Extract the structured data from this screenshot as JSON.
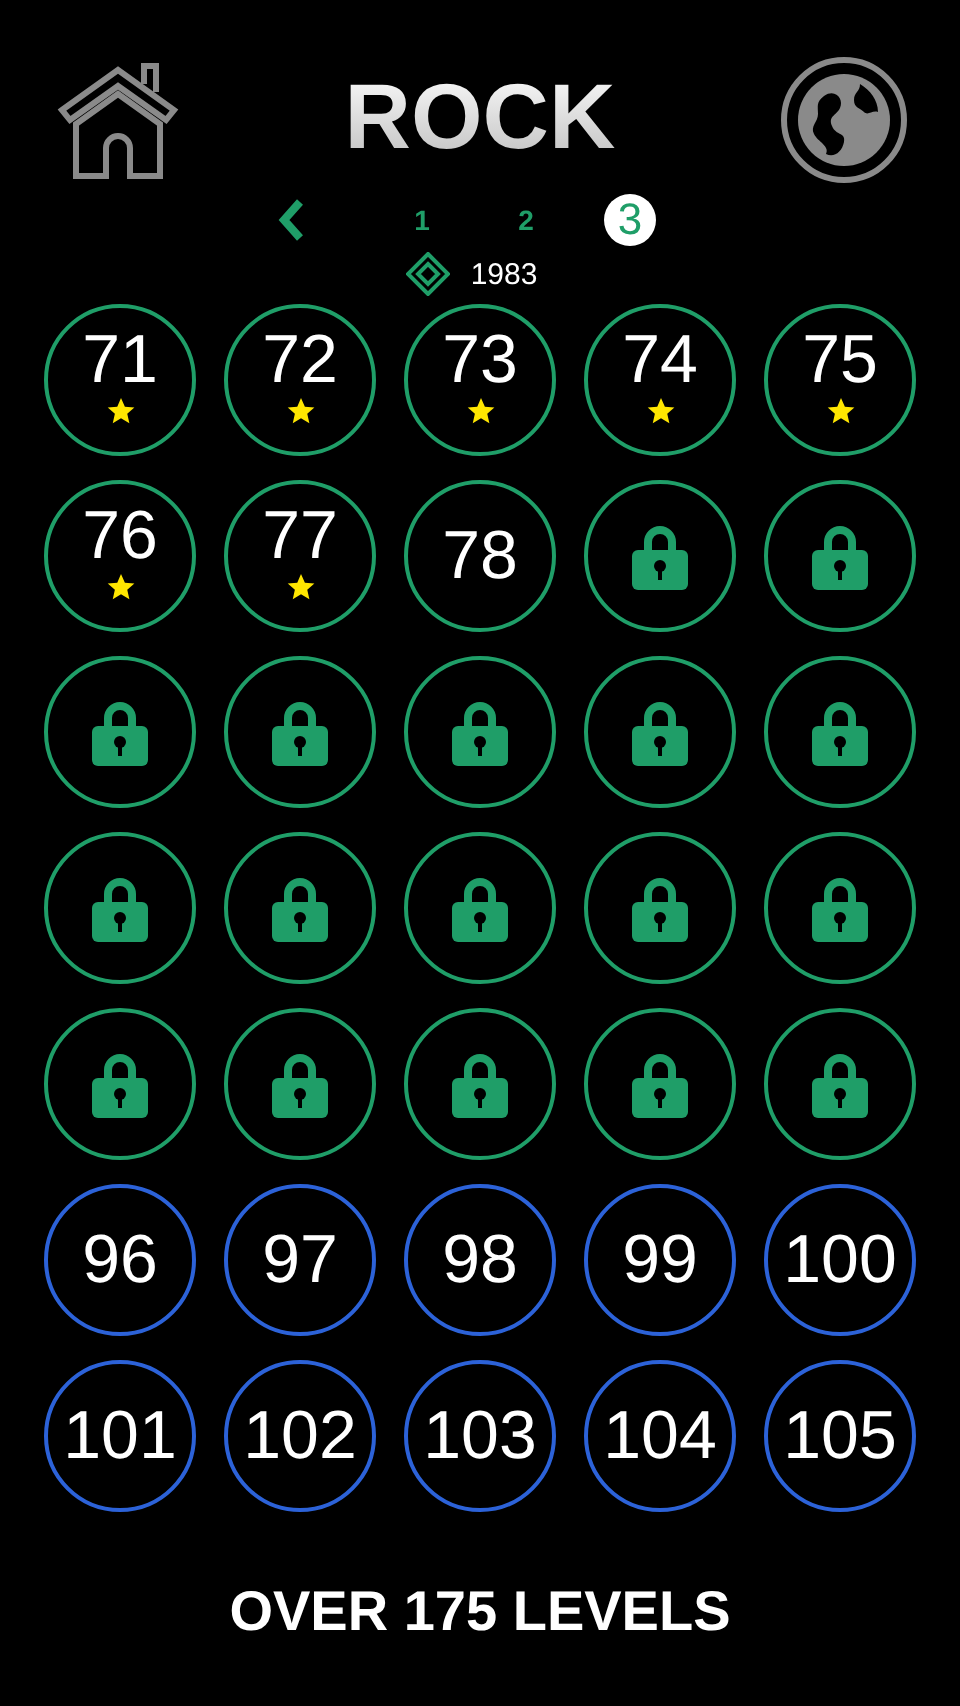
{
  "title": "ROCK",
  "pages": [
    {
      "label": "1",
      "selected": false
    },
    {
      "label": "2",
      "selected": false
    },
    {
      "label": "3",
      "selected": true
    }
  ],
  "score": "1983",
  "levels": [
    {
      "kind": "open",
      "label": "71",
      "starred": true,
      "color": "#1f9e68"
    },
    {
      "kind": "open",
      "label": "72",
      "starred": true,
      "color": "#1f9e68"
    },
    {
      "kind": "open",
      "label": "73",
      "starred": true,
      "color": "#1f9e68"
    },
    {
      "kind": "open",
      "label": "74",
      "starred": true,
      "color": "#1f9e68"
    },
    {
      "kind": "open",
      "label": "75",
      "starred": true,
      "color": "#1f9e68"
    },
    {
      "kind": "open",
      "label": "76",
      "starred": true,
      "color": "#1f9e68"
    },
    {
      "kind": "open",
      "label": "77",
      "starred": true,
      "color": "#1f9e68"
    },
    {
      "kind": "open",
      "label": "78",
      "starred": false,
      "color": "#1f9e68"
    },
    {
      "kind": "locked",
      "color": "#1f9e68"
    },
    {
      "kind": "locked",
      "color": "#1f9e68"
    },
    {
      "kind": "locked",
      "color": "#1f9e68"
    },
    {
      "kind": "locked",
      "color": "#1f9e68"
    },
    {
      "kind": "locked",
      "color": "#1f9e68"
    },
    {
      "kind": "locked",
      "color": "#1f9e68"
    },
    {
      "kind": "locked",
      "color": "#1f9e68"
    },
    {
      "kind": "locked",
      "color": "#1f9e68"
    },
    {
      "kind": "locked",
      "color": "#1f9e68"
    },
    {
      "kind": "locked",
      "color": "#1f9e68"
    },
    {
      "kind": "locked",
      "color": "#1f9e68"
    },
    {
      "kind": "locked",
      "color": "#1f9e68"
    },
    {
      "kind": "locked",
      "color": "#1f9e68"
    },
    {
      "kind": "locked",
      "color": "#1f9e68"
    },
    {
      "kind": "locked",
      "color": "#1f9e68"
    },
    {
      "kind": "locked",
      "color": "#1f9e68"
    },
    {
      "kind": "locked",
      "color": "#1f9e68"
    },
    {
      "kind": "open",
      "label": "96",
      "starred": false,
      "color": "#2c62d8"
    },
    {
      "kind": "open",
      "label": "97",
      "starred": false,
      "color": "#2c62d8"
    },
    {
      "kind": "open",
      "label": "98",
      "starred": false,
      "color": "#2c62d8"
    },
    {
      "kind": "open",
      "label": "99",
      "starred": false,
      "color": "#2c62d8"
    },
    {
      "kind": "open",
      "label": "100",
      "starred": false,
      "color": "#2c62d8"
    },
    {
      "kind": "open",
      "label": "101",
      "starred": false,
      "color": "#2c62d8"
    },
    {
      "kind": "open",
      "label": "102",
      "starred": false,
      "color": "#2c62d8"
    },
    {
      "kind": "open",
      "label": "103",
      "starred": false,
      "color": "#2c62d8"
    },
    {
      "kind": "open",
      "label": "104",
      "starred": false,
      "color": "#2c62d8"
    },
    {
      "kind": "open",
      "label": "105",
      "starred": false,
      "color": "#2c62d8"
    }
  ],
  "footer": "OVER 175 LEVELS"
}
